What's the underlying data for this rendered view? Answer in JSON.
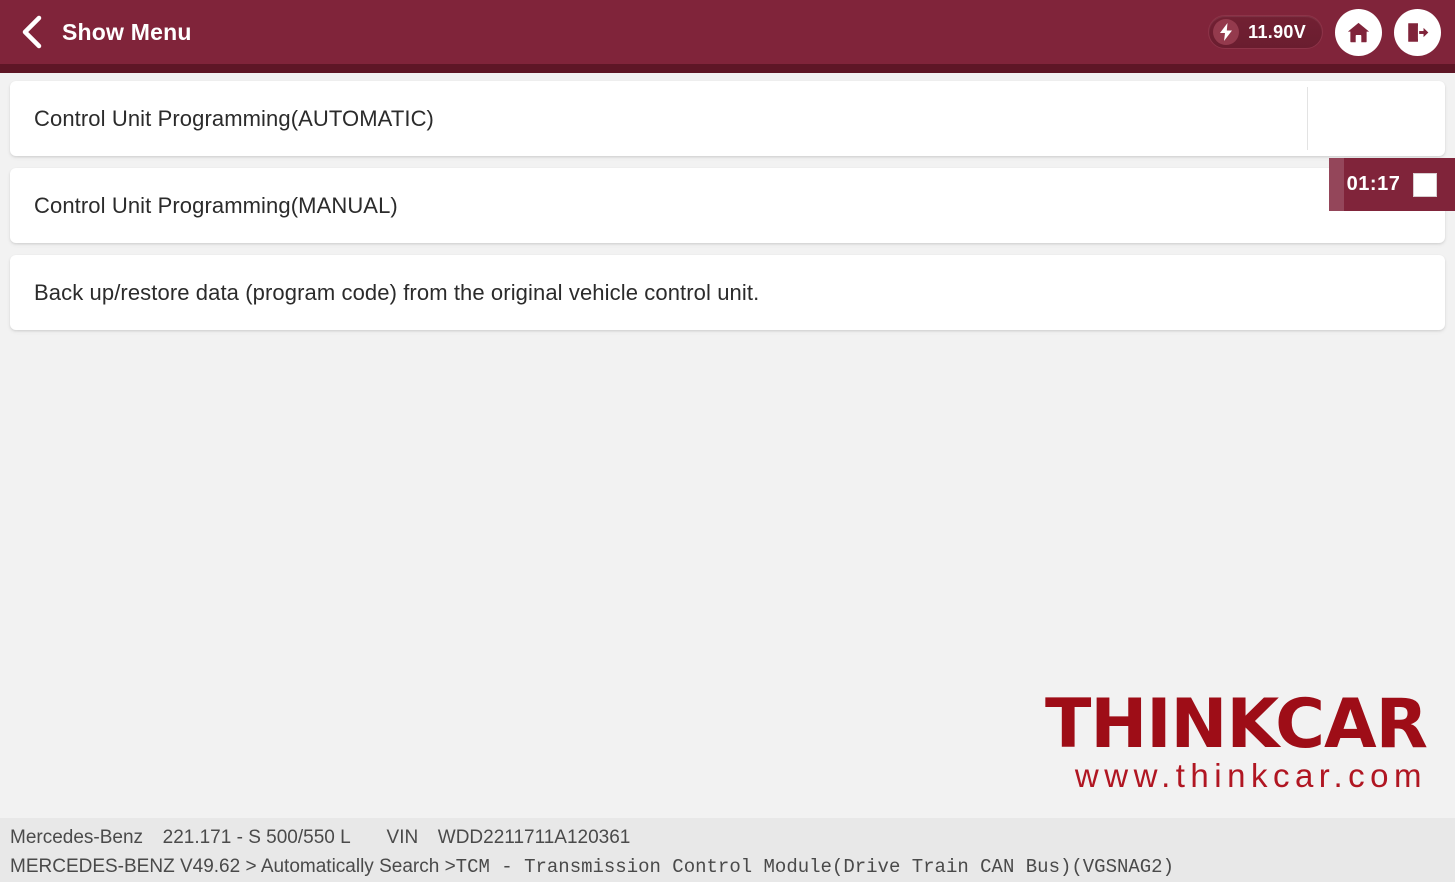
{
  "header": {
    "back_icon": "chevron-left-icon",
    "title": "Show Menu",
    "voltage": {
      "icon": "lightning-bolt-icon",
      "value": "11.90V"
    },
    "home_icon": "home-icon",
    "exit_icon": "exit-icon"
  },
  "timer": {
    "elapsed": "01:17",
    "stop_icon": "stop-square-icon"
  },
  "menu": {
    "items": [
      {
        "label": "Control Unit Programming(AUTOMATIC)"
      },
      {
        "label": "Control Unit Programming(MANUAL)"
      },
      {
        "label": "Back up/restore data (program code) from the original vehicle control unit."
      }
    ]
  },
  "brand": {
    "name": "THINKCAR",
    "url": "www.thinkcar.com"
  },
  "footer": {
    "vehicle_make": "Mercedes-Benz",
    "vehicle_model": "221.171 - S 500/550 L",
    "vin_label": "VIN",
    "vin_value": "WDD2211711A120361",
    "software": "MERCEDES-BENZ V49.62",
    "path_separator_1": ">",
    "path_step_1": "Automatically Search",
    "path_separator_2": ">",
    "path_step_2": "TCM - Transmission Control Module(Drive Train CAN Bus)(VGSNAG2)"
  }
}
